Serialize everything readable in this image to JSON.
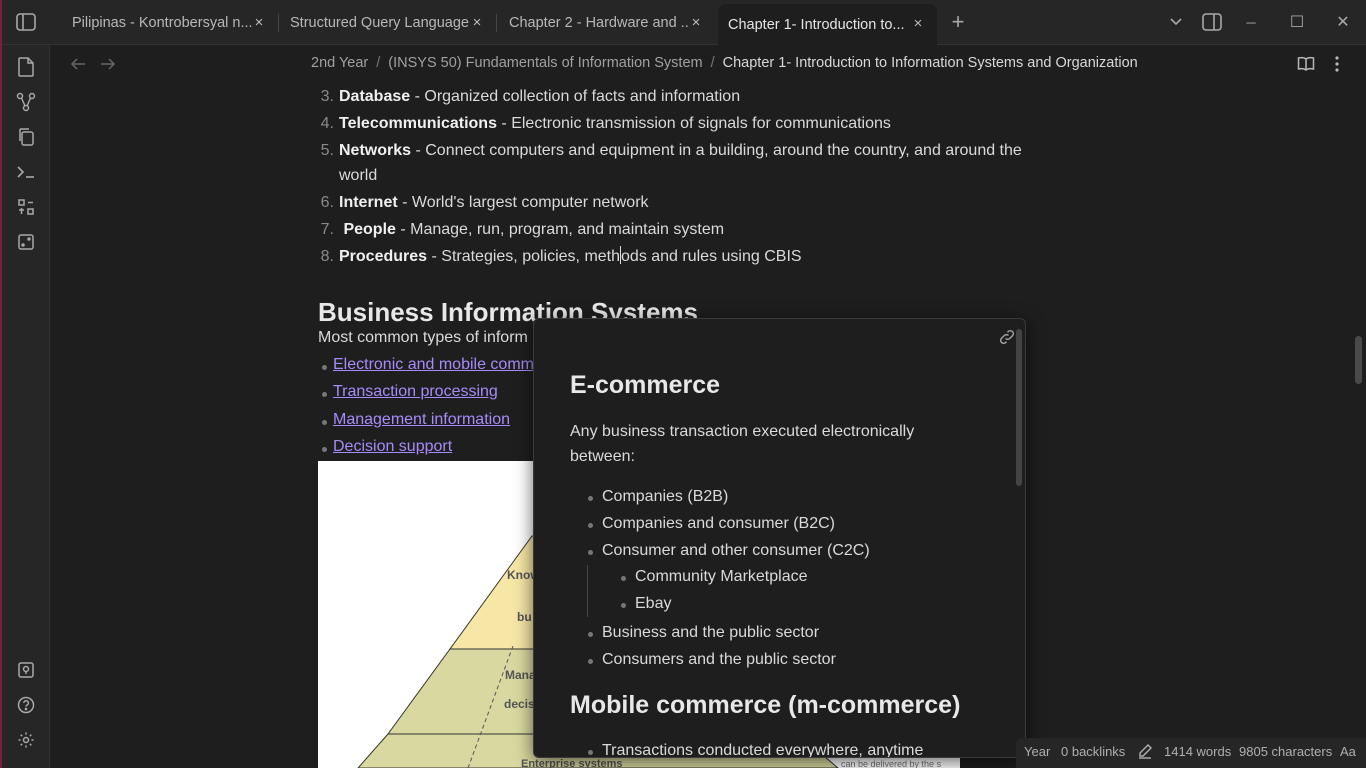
{
  "tabs": [
    {
      "label": "Pilipinas - Kontrobersyal n..."
    },
    {
      "label": "Structured Query Language"
    },
    {
      "label": "Chapter 2 - Hardware and ..."
    },
    {
      "label": "Chapter 1- Introduction to..."
    }
  ],
  "tab_controls": {
    "new_tab": "+",
    "close": "×",
    "minimize": "─",
    "maximize": "☐",
    "window_close": "✕"
  },
  "breadcrumb": {
    "part1": "2nd Year",
    "part2": "(INSYS 50) Fundamentals of Information System",
    "current": "Chapter 1- Introduction to Information Systems and Organization",
    "separator": "/"
  },
  "list": [
    {
      "num": "3.",
      "term": "Database",
      "desc": " - Organized collection of facts and information"
    },
    {
      "num": "4.",
      "term": "Telecommunications",
      "desc": " - Electronic transmission of signals for communications"
    },
    {
      "num": "5.",
      "term": "Networks",
      "desc": " - Connect computers and equipment in a building, around the country, and around the",
      "cont": "world"
    },
    {
      "num": "6.",
      "term": "Internet",
      "desc": " - World's largest computer network"
    },
    {
      "num": "7.",
      "term": " People",
      "desc": " - Manage, run, program, and maintain system"
    },
    {
      "num": "8.",
      "term": "Procedures",
      "desc_a": " - Strategies, policies, meth",
      "desc_b": "ods and rules using CBIS"
    }
  ],
  "section": {
    "heading": "Business Information Systems",
    "intro": "Most common types of inform"
  },
  "links": [
    {
      "label": "Electronic and mobile comm"
    },
    {
      "label": "Transaction processing"
    },
    {
      "label": "Management information"
    },
    {
      "label": "Decision support"
    }
  ],
  "pyramid": {
    "labels": [
      "Know",
      "bu",
      "Mana",
      "decis",
      "Enterprise systems",
      "can be delivered by the s"
    ]
  },
  "popover": {
    "h1": "E-commerce",
    "p": "Any business transaction executed electronically between:",
    "items": [
      {
        "label": "Companies (B2B)"
      },
      {
        "label": "Companies and consumer (B2C)"
      },
      {
        "label": "Consumer and other consumer (C2C)"
      },
      {
        "label": "Business and the public sector"
      },
      {
        "label": "Consumers and the public sector"
      }
    ],
    "subitems": [
      {
        "label": "Community Marketplace"
      },
      {
        "label": "Ebay"
      }
    ],
    "h2": "Mobile commerce (m-commerce)",
    "last": "Transactions conducted everywhere, anytime"
  },
  "status": {
    "folder": "Year",
    "backlinks": "0 backlinks",
    "words": "1414 words",
    "characters": "9805 characters",
    "font_toggle": "Aa"
  },
  "colors": {
    "accent": "#a88bfa",
    "background": "#1e1e1e",
    "chrome": "#262626",
    "left_accent": "#7a1f3a"
  }
}
